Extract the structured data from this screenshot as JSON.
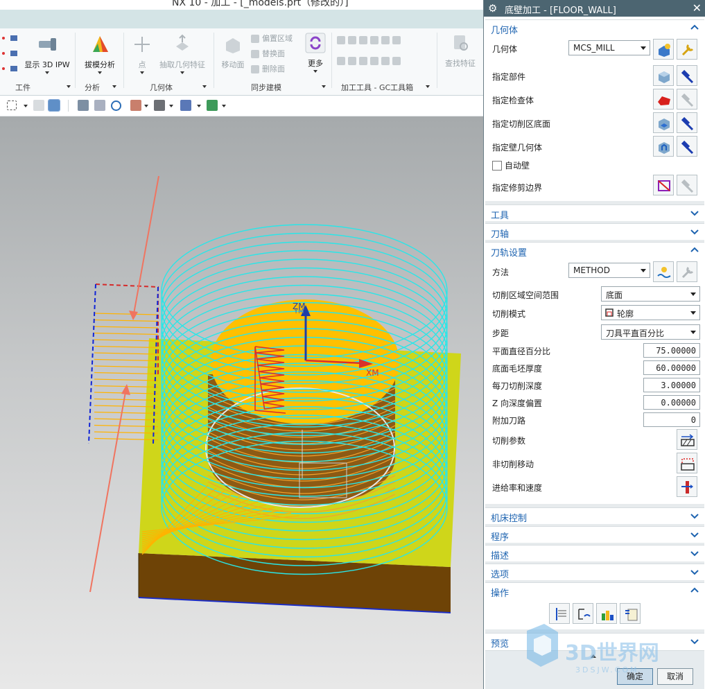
{
  "app": {
    "window_title": "NX 10 - 加工 - [_models.prt（修改的）]",
    "ribbon": {
      "groups": [
        {
          "label": "工件"
        },
        {
          "label": "分析"
        },
        {
          "label": "几何体"
        },
        {
          "label": "同步建模"
        },
        {
          "label": "加工工具 - GC工具箱"
        }
      ],
      "buttons": {
        "show_3d_ipw": "显示 3D IPW",
        "draft_analysis": "拔模分析",
        "point": "点",
        "extract_geometry": "抽取几何特征",
        "move_face": "移动面",
        "offset_region": "偏置区域",
        "replace_face": "替换面",
        "delete_face": "删除面",
        "more": "更多",
        "find_feature": "查找特征"
      }
    },
    "viewport": {
      "axis_zm": "ZM",
      "axis_ym": "YM",
      "axis_xm": "XM"
    }
  },
  "dialog": {
    "title": "底壁加工 - [FLOOR_WALL]",
    "sections": {
      "geometry": {
        "title": "几何体",
        "expanded": true,
        "geometry_label": "几何体",
        "geometry_value": "MCS_MILL",
        "specify_part": "指定部件",
        "specify_check": "指定检查体",
        "specify_floor": "指定切削区底面",
        "specify_wall": "指定壁几何体",
        "auto_wall": "自动壁",
        "auto_wall_checked": false,
        "specify_trim": "指定修剪边界"
      },
      "tool": {
        "title": "工具",
        "expanded": false
      },
      "axis": {
        "title": "刀轴",
        "expanded": false
      },
      "path_settings": {
        "title": "刀轨设置",
        "expanded": true,
        "method_label": "方法",
        "method_value": "METHOD",
        "cut_region_label": "切削区域空间范围",
        "cut_region_value": "底面",
        "cut_pattern_label": "切削模式",
        "cut_pattern_value": "轮廓",
        "stepover_label": "步距",
        "stepover_value": "刀具平直百分比",
        "flat_diameter_label": "平面直径百分比",
        "flat_diameter_value": "75.00000",
        "floor_stock_label": "底面毛坯厚度",
        "floor_stock_value": "60.00000",
        "depth_per_cut_label": "每刀切削深度",
        "depth_per_cut_value": "3.00000",
        "z_offset_label": "Z 向深度偏置",
        "z_offset_value": "0.00000",
        "additional_passes_label": "附加刀路",
        "additional_passes_value": "0",
        "cutting_params_label": "切削参数",
        "non_cutting_label": "非切削移动",
        "feeds_label": "进给率和速度"
      },
      "machine_control": {
        "title": "机床控制",
        "expanded": false
      },
      "program": {
        "title": "程序",
        "expanded": false
      },
      "description": {
        "title": "描述",
        "expanded": false
      },
      "options": {
        "title": "选项",
        "expanded": false
      },
      "actions": {
        "title": "操作",
        "expanded": true
      },
      "preview": {
        "title": "预览",
        "expanded": false
      }
    },
    "ok_label": "确定",
    "cancel_label": "取消"
  },
  "watermark": "3DSJW.COM"
}
